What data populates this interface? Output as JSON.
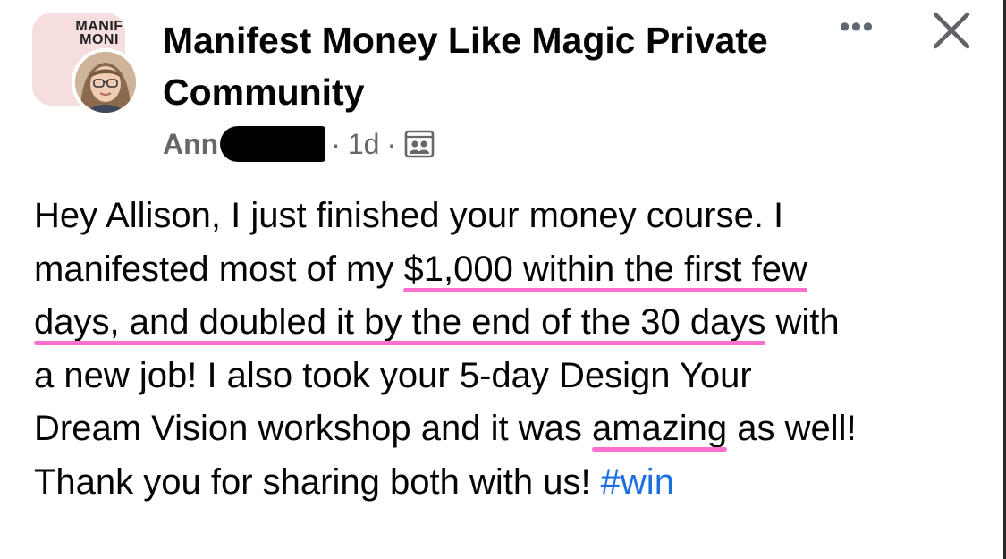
{
  "post": {
    "group": {
      "name": "Manifest Money Like Magic Private Community",
      "avatar_text_line1": "MANIF",
      "avatar_text_line2": "MONI"
    },
    "author": {
      "name_visible": "Ann"
    },
    "timestamp": "1d",
    "separator": "·",
    "audience_icon": "members-icon",
    "actions": {
      "more_icon": "ellipsis-icon",
      "more_glyph": "•••",
      "close_icon": "close-icon"
    },
    "body": {
      "line1": "Hey Allison, I just finished your money course. I",
      "line2_a": "manifested most of my ",
      "line2_hl": "$1,000 within the first few",
      "line3_hl": "days, and doubled it by the end of the 30 days",
      "line3_b": " with",
      "line4": "a new job! I also took your 5-day Design Your",
      "line5_a": "Dream Vision workshop and it was ",
      "line5_hl": "amazing",
      "line5_b": " as well!",
      "line6_a": "Thank you for sharing both with us! ",
      "hashtag": "#win"
    }
  },
  "colors": {
    "highlight_underline": "#ff6fcf",
    "hashtag": "#1b6fe0",
    "meta_text": "#65676b",
    "group_avatar_bg": "#f7dede"
  }
}
